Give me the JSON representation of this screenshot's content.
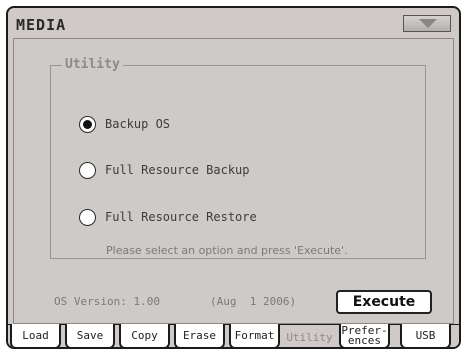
{
  "header": {
    "title": "MEDIA",
    "menu_icon": "triangle-down-icon"
  },
  "panel": {
    "title": "Utility",
    "options": [
      {
        "label": "Backup OS",
        "selected": true
      },
      {
        "label": "Full Resource Backup",
        "selected": false
      },
      {
        "label": "Full Resource Restore",
        "selected": false
      }
    ],
    "hint": "Please select an option and press 'Execute'."
  },
  "footer": {
    "os_version": "OS Version: 1.00",
    "os_date": "(Aug  1 2006)",
    "execute_label": "Execute"
  },
  "tabs": [
    {
      "label": "Load",
      "active": false
    },
    {
      "label": "Save",
      "active": false
    },
    {
      "label": "Copy",
      "active": false
    },
    {
      "label": "Erase",
      "active": false
    },
    {
      "label": "Format",
      "active": false
    },
    {
      "label": "Utility",
      "active": true
    },
    {
      "label": "Prefer-\nences",
      "active": false
    },
    {
      "label": "USB",
      "active": false
    }
  ],
  "colors": {
    "background": "#cfcac8",
    "border": "#1b1b1b",
    "muted_text": "#7d7976"
  }
}
